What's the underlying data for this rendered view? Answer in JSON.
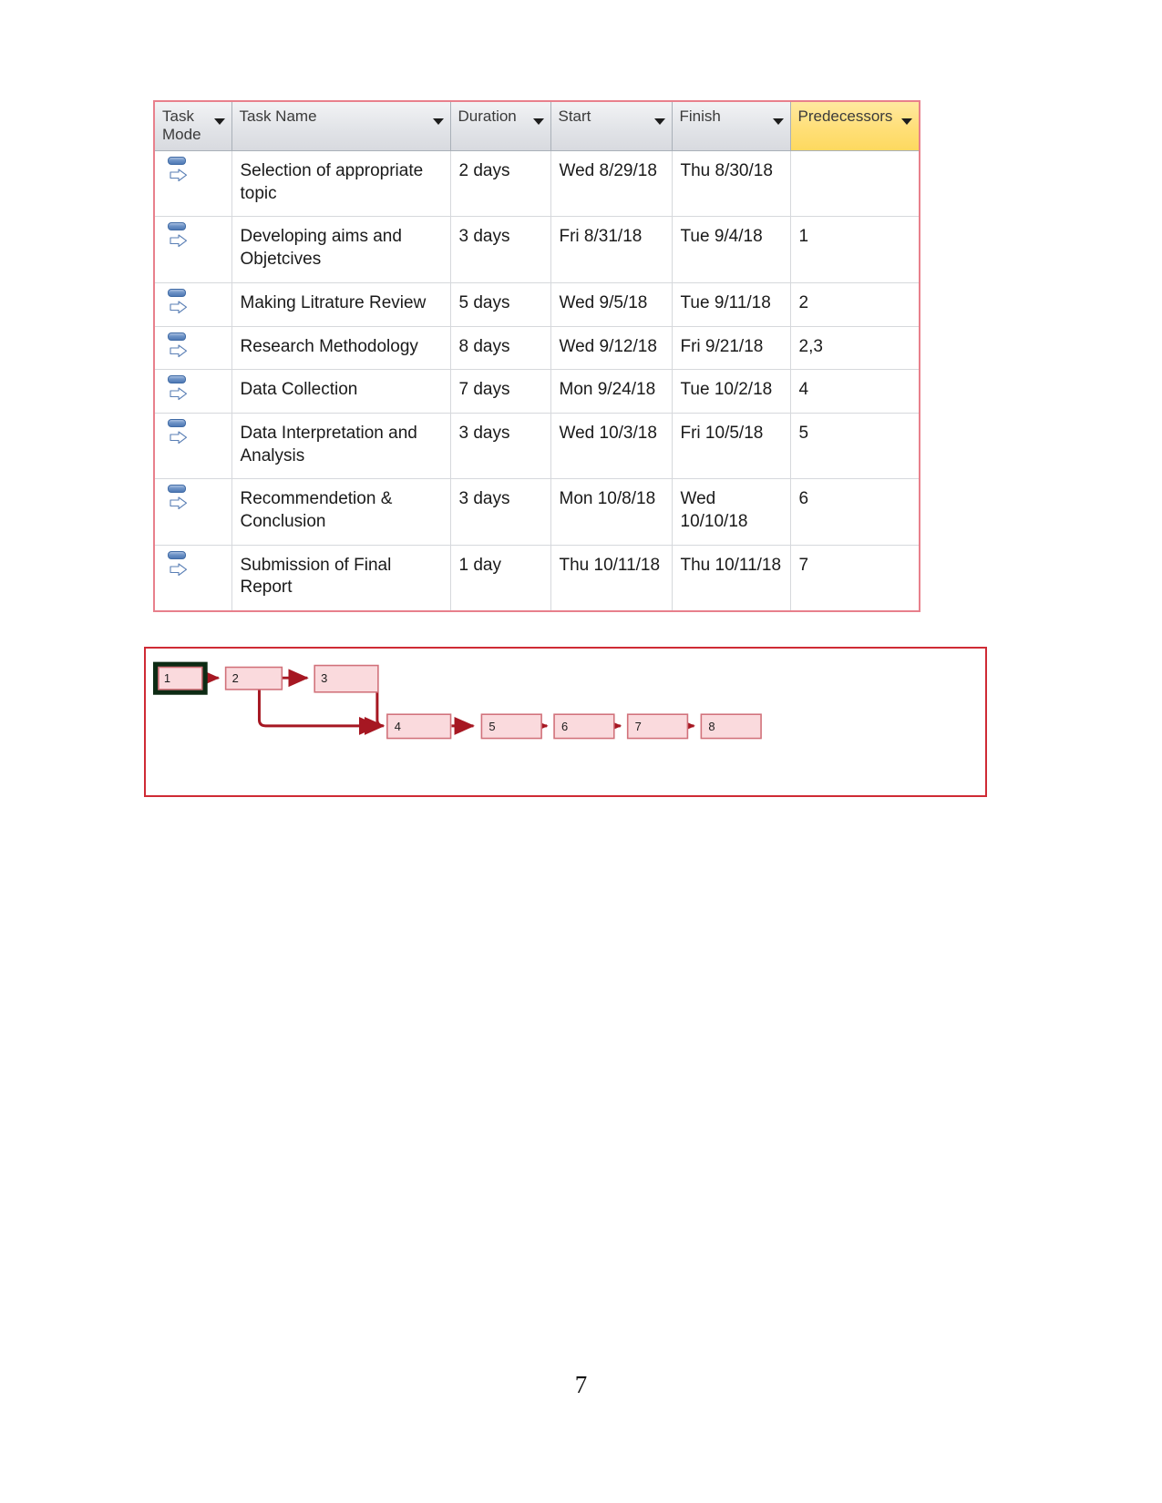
{
  "document": {
    "page_number": "7"
  },
  "task_table": {
    "columns": [
      {
        "key": "task_mode",
        "label": "Task Mode",
        "has_filter_arrow": true,
        "header_color": "#e2e4e8"
      },
      {
        "key": "task_name",
        "label": "Task Name",
        "has_filter_arrow": true,
        "header_color": "#e2e4e8"
      },
      {
        "key": "duration",
        "label": "Duration",
        "has_filter_arrow": true,
        "header_color": "#e2e4e8"
      },
      {
        "key": "start",
        "label": "Start",
        "has_filter_arrow": true,
        "header_color": "#e2e4e8"
      },
      {
        "key": "finish",
        "label": "Finish",
        "has_filter_arrow": true,
        "header_color": "#e2e4e8"
      },
      {
        "key": "predecessors",
        "label": "Predecessors",
        "has_filter_arrow": true,
        "header_color": "#fdd95f"
      }
    ],
    "border_color": "#e8808c",
    "rows": [
      {
        "task_mode_icon": "auto-scheduled-icon",
        "task_name": "Selection of appropriate topic",
        "duration": "2 days",
        "start": "Wed 8/29/18",
        "finish": "Thu 8/30/18",
        "predecessors": ""
      },
      {
        "task_mode_icon": "auto-scheduled-icon",
        "task_name": "Developing aims and Objetcives",
        "duration": "3 days",
        "start": "Fri 8/31/18",
        "finish": "Tue 9/4/18",
        "predecessors": "1"
      },
      {
        "task_mode_icon": "auto-scheduled-icon",
        "task_name": "Making Litrature Review",
        "duration": "5 days",
        "start": "Wed 9/5/18",
        "finish": "Tue 9/11/18",
        "predecessors": "2"
      },
      {
        "task_mode_icon": "auto-scheduled-icon",
        "task_name": "Research Methodology",
        "duration": "8 days",
        "start": "Wed 9/12/18",
        "finish": "Fri 9/21/18",
        "predecessors": "2,3"
      },
      {
        "task_mode_icon": "auto-scheduled-icon",
        "task_name": "Data Collection",
        "duration": "7 days",
        "start": "Mon 9/24/18",
        "finish": "Tue 10/2/18",
        "predecessors": "4"
      },
      {
        "task_mode_icon": "auto-scheduled-icon",
        "task_name": "Data Interpretation and Analysis",
        "duration": "3 days",
        "start": "Wed 10/3/18",
        "finish": "Fri 10/5/18",
        "predecessors": "5"
      },
      {
        "task_mode_icon": "auto-scheduled-icon",
        "task_name": "Recommendetion & Conclusion",
        "duration": "3 days",
        "start": "Mon 10/8/18",
        "finish": "Wed 10/10/18",
        "predecessors": "6"
      },
      {
        "task_mode_icon": "auto-scheduled-icon",
        "task_name": "Submission of Final Report",
        "duration": "1 day",
        "start": "Thu 10/11/18",
        "finish": "Thu 10/11/18",
        "predecessors": "7"
      }
    ]
  },
  "network_diagram": {
    "border_color": "#cf2b35",
    "node_fill": "#fadadd",
    "node_stroke": "#d1717a",
    "link_color": "#a61722",
    "selected_node_outline": "#0d2b14",
    "nodes": [
      {
        "id": "1",
        "label": "1",
        "selected": true
      },
      {
        "id": "2",
        "label": "2",
        "selected": false
      },
      {
        "id": "3",
        "label": "3",
        "selected": false
      },
      {
        "id": "4",
        "label": "4",
        "selected": false
      },
      {
        "id": "5",
        "label": "5",
        "selected": false
      },
      {
        "id": "6",
        "label": "6",
        "selected": false
      },
      {
        "id": "7",
        "label": "7",
        "selected": false
      },
      {
        "id": "8",
        "label": "8",
        "selected": false
      }
    ],
    "links": [
      {
        "from": "1",
        "to": "2"
      },
      {
        "from": "2",
        "to": "3"
      },
      {
        "from": "2",
        "to": "4"
      },
      {
        "from": "3",
        "to": "4"
      },
      {
        "from": "4",
        "to": "5"
      },
      {
        "from": "5",
        "to": "6"
      },
      {
        "from": "6",
        "to": "7"
      },
      {
        "from": "7",
        "to": "8"
      }
    ]
  }
}
